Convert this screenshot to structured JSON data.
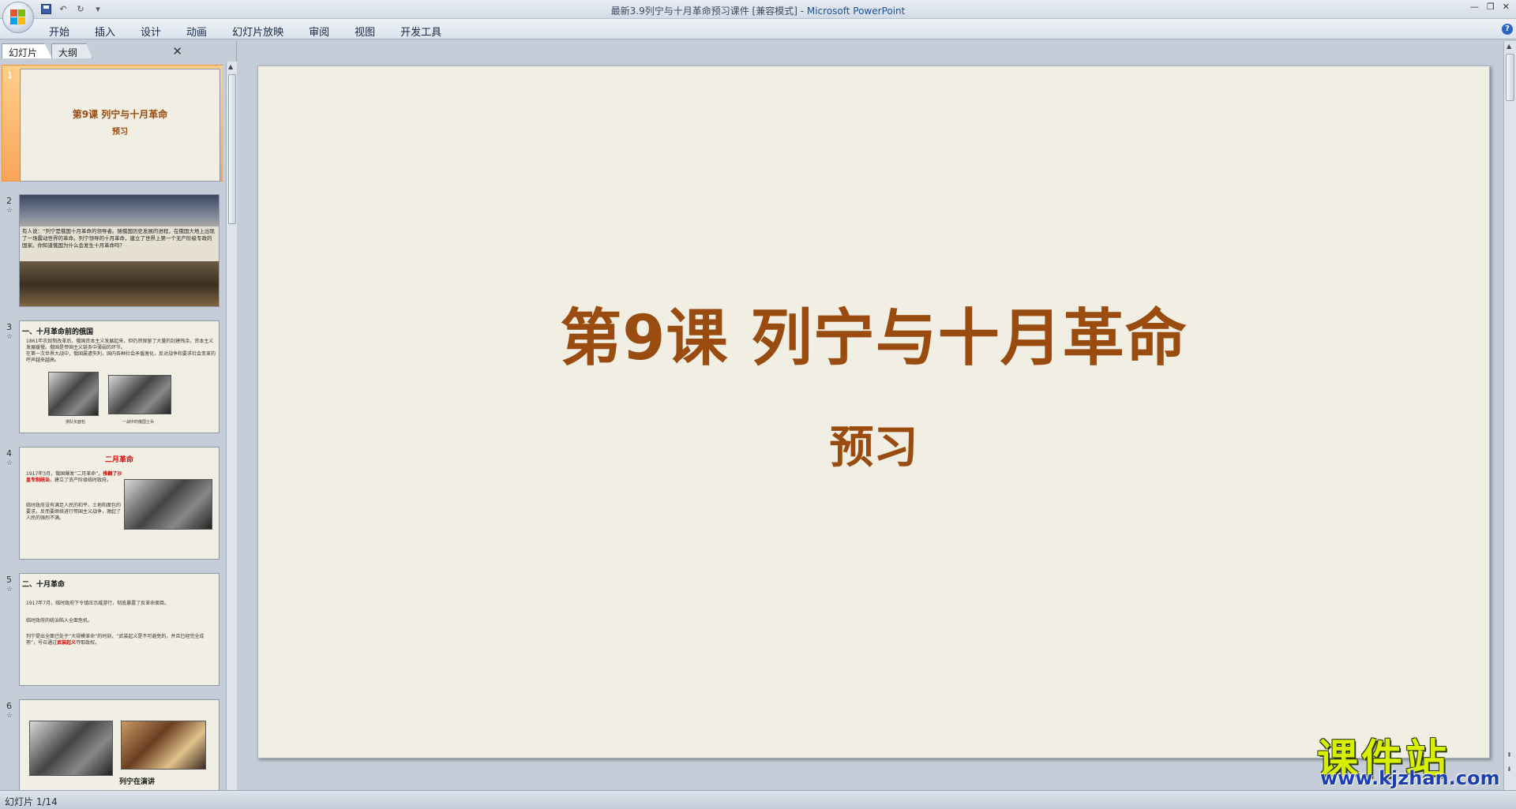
{
  "window": {
    "title": "最新3.9列宁与十月革命预习课件 [兼容模式] - ",
    "app_name": "Microsoft PowerPoint"
  },
  "ribbon": {
    "tabs": [
      "开始",
      "插入",
      "设计",
      "动画",
      "幻灯片放映",
      "审阅",
      "视图",
      "开发工具"
    ]
  },
  "pane": {
    "tab_slides": "幻灯片",
    "tab_outline": "大纲",
    "close": "✕"
  },
  "thumbnails": {
    "s1": {
      "num": "1",
      "title": "第9课 列宁与十月革命",
      "subtitle": "预习"
    },
    "s2": {
      "num": "2",
      "text": "有人说：“列宁是俄国十月革命的领导者。随俄国历史发展的进程，在俄国大地上出现了一场震动世界的革命。列宁领导的十月革命，建立了世界上第一个无产阶级专政的国家。你知道俄国为什么会发生十月革命吗？"
    },
    "s3": {
      "num": "3",
      "heading": "一、十月革命前的俄国",
      "para1": "1861年农奴制改革后，俄国资本主义发展起来，但仍然保留了大量的封建残余，资本主义发展缓慢。俄国是帝国主义链条中薄弱的环节。",
      "para2": "在第一次世界大战中，俄国屡遭失利，国内各种社会矛盾激化，反对战争和要求社会变革的呼声越来越高。",
      "cap1": "排队买面包",
      "cap2": "一战中的俄国士兵"
    },
    "s4": {
      "num": "4",
      "heading": "二月革命",
      "line1": "1917年3月，俄国爆发“二月革命”，",
      "line_red": "推翻了沙皇专制统治",
      "line2": "，建立了资产阶级临时政府。",
      "line3": "临时政府没有满足人民的和平、土地和面包的要求，反而要继续进行帝国主义战争，激起了人民的强烈不满。"
    },
    "s5": {
      "num": "5",
      "heading": "二、十月革命",
      "p1": "1917年7月，临时政府下令镇压示威游行，彻底暴露了反革命面目。",
      "p2": "临时政府的统治陷入全面危机。",
      "p3": "列宁提出全面已处于“大规模革命”的时刻，“武装起义是不可避免的，并且已经完全成熟”，号召通过",
      "p3_red": "武装起义",
      "p3_end": "夺取政权。"
    },
    "s6": {
      "num": "6",
      "caption": "列宁在演讲"
    }
  },
  "slide": {
    "title": "第9课 列宁与十月革命",
    "subtitle": "预习"
  },
  "watermark": {
    "main": "课件站",
    "url": "www.kjzhan.com"
  },
  "status": {
    "slide_indicator": "幻灯片 1/14"
  }
}
